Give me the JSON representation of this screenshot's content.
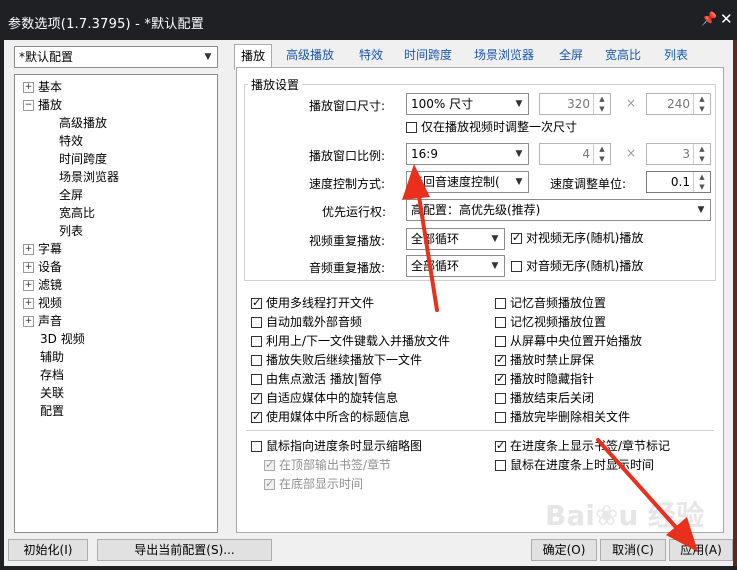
{
  "window": {
    "title": "参数选项(1.7.3795) - *默认配置",
    "pin_icon": "pin-icon",
    "close_icon": "close-icon"
  },
  "profile_select": {
    "value": "*默认配置"
  },
  "tree": {
    "items": [
      {
        "label": "基本",
        "expander": "+"
      },
      {
        "label": "播放",
        "expander": "-"
      },
      {
        "label": "高级播放"
      },
      {
        "label": "特效"
      },
      {
        "label": "时间跨度"
      },
      {
        "label": "场景浏览器"
      },
      {
        "label": "全屏"
      },
      {
        "label": "宽高比"
      },
      {
        "label": "列表"
      },
      {
        "label": "字幕",
        "expander": "+"
      },
      {
        "label": "设备",
        "expander": "+"
      },
      {
        "label": "滤镜",
        "expander": "+"
      },
      {
        "label": "视频",
        "expander": "+"
      },
      {
        "label": "声音",
        "expander": "+"
      },
      {
        "label": "3D 视频"
      },
      {
        "label": "辅助"
      },
      {
        "label": "存档"
      },
      {
        "label": "关联"
      },
      {
        "label": "配置"
      }
    ]
  },
  "tabs": [
    "播放",
    "高级播放",
    "特效",
    "时间跨度",
    "场景浏览器",
    "全屏",
    "宽高比",
    "列表"
  ],
  "playback": {
    "group_title": "播放设置",
    "window_size_label": "播放窗口尺寸:",
    "window_size_value": "100% 尺寸",
    "width_value": "320",
    "height_value": "240",
    "times_sign": "×",
    "adjust_once_label": "仅在播放视频时调整一次尺寸",
    "ratio_label": "播放窗口比例:",
    "ratio_value": "16:9",
    "ratio_w": "4",
    "ratio_h": "3",
    "speed_mode_label": "速度控制方式:",
    "speed_mode_value": "无回音速度控制(",
    "speed_unit_label": "速度调整单位:",
    "speed_unit_value": "0.1",
    "priority_label": "优先运行权:",
    "priority_value": "高配置：高优先级(推荐)",
    "video_repeat_label": "视频重复播放:",
    "video_repeat_value": "全部循环",
    "video_shuffle_label": "对视频无序(随机)播放",
    "audio_repeat_label": "音频重复播放:",
    "audio_repeat_value": "全部循环",
    "audio_shuffle_label": "对音频无序(随机)播放"
  },
  "options_left": [
    {
      "label": "使用多线程打开文件",
      "checked": true
    },
    {
      "label": "自动加载外部音频",
      "checked": false
    },
    {
      "label": "利用上/下一文件键载入并播放文件",
      "checked": false
    },
    {
      "label": "播放失败后继续播放下一文件",
      "checked": false
    },
    {
      "label": "由焦点激活 播放|暂停",
      "checked": false
    },
    {
      "label": "自适应媒体中的旋转信息",
      "checked": true
    },
    {
      "label": "使用媒体中所含的标题信息",
      "checked": true
    }
  ],
  "options_right": [
    {
      "label": "记忆音频播放位置",
      "checked": false
    },
    {
      "label": "记忆视频播放位置",
      "checked": false
    },
    {
      "label": "从屏幕中央位置开始播放",
      "checked": false
    },
    {
      "label": "播放时禁止屏保",
      "checked": true
    },
    {
      "label": "播放时隐藏指针",
      "checked": true
    },
    {
      "label": "播放结束后关闭",
      "checked": false
    },
    {
      "label": "播放完毕删除相关文件",
      "checked": false
    }
  ],
  "seekbar_left": [
    {
      "label": "鼠标指向进度条时显示缩略图",
      "checked": false,
      "dim": false
    },
    {
      "label": "在顶部输出书签/章节",
      "checked": true,
      "dim": true
    },
    {
      "label": "在底部显示时间",
      "checked": true,
      "dim": true
    }
  ],
  "seekbar_right": [
    {
      "label": "在进度条上显示书签/章节标记",
      "checked": true
    },
    {
      "label": "鼠标在进度条上时显示时间",
      "checked": false
    }
  ],
  "buttons": {
    "init": "初始化(I)",
    "export": "导出当前配置(S)...",
    "ok": "确定(O)",
    "cancel": "取消(C)",
    "apply": "应用(A)"
  },
  "watermark": "Baidu 经验",
  "colors": {
    "annotation_arrow": "#e8301c",
    "title_bar": "#1f2024",
    "tab_link": "#1a56b0"
  }
}
